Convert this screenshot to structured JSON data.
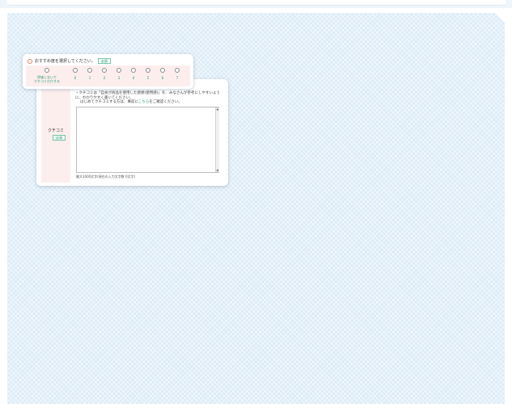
{
  "form": {
    "rating_title": "おすすめ度を選択してください。",
    "required_label": "必須",
    "rating_options": [
      {
        "label_line1": "評価しないで",
        "label_line2": "クチコミだけする"
      },
      {
        "label": "0"
      },
      {
        "label": "1"
      },
      {
        "label": "2"
      },
      {
        "label": "3"
      },
      {
        "label": "4"
      },
      {
        "label": "5"
      },
      {
        "label": "6"
      },
      {
        "label": "7"
      }
    ],
    "review_label": "クチコミ",
    "note_line1": "クチコミは「自身が商品を使用した感想(使用感)」を、みなさんが参考にしやすいように、わかりやすく書いてください。",
    "note_line2_pre": "はじめてクチコミする方は、事前に",
    "note_line2_link": "こちら",
    "note_line2_post": "をご確認ください。",
    "textarea_value": "",
    "counter_text": "最大1000文字(現在の入力文字数 0文字)"
  }
}
